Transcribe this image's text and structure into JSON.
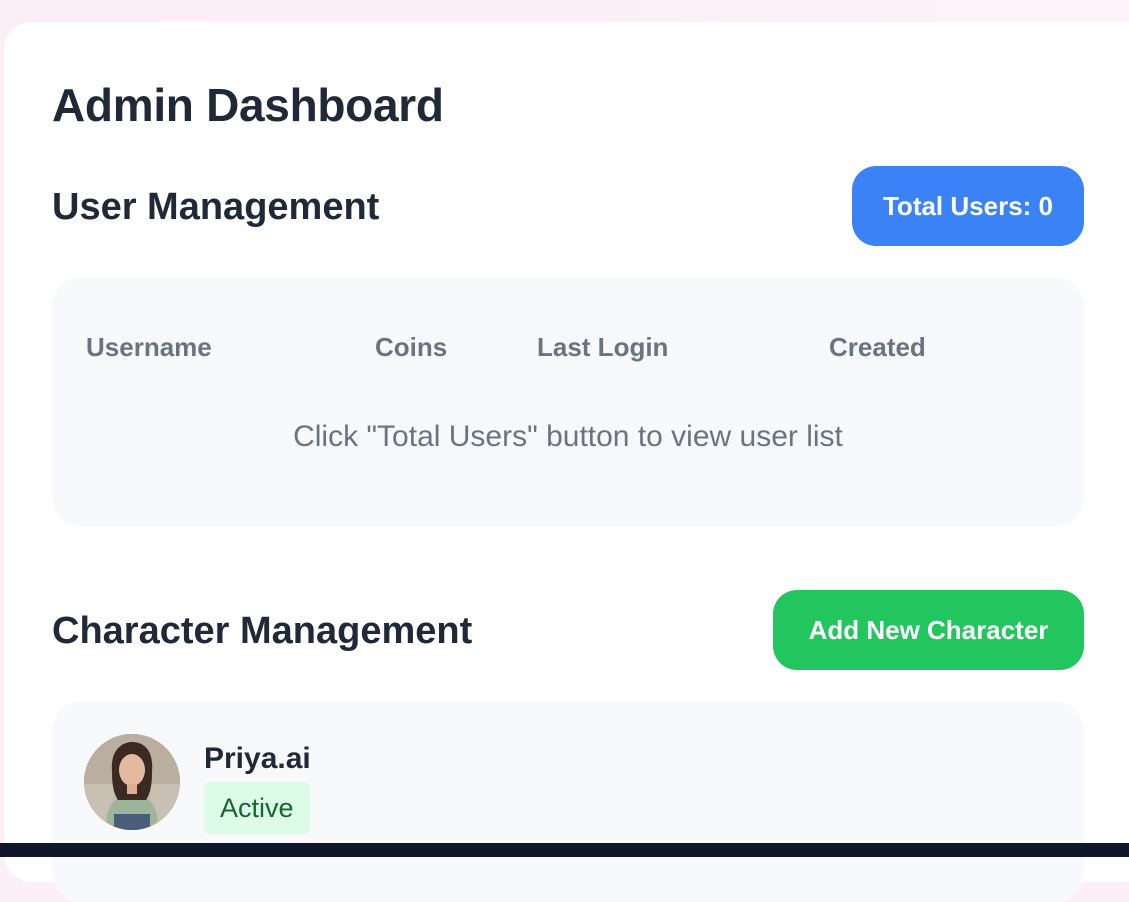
{
  "page": {
    "title": "Admin Dashboard"
  },
  "user_management": {
    "title": "User Management",
    "total_users_label": "Total Users: 0",
    "columns": [
      "Username",
      "Coins",
      "Last Login",
      "Created"
    ],
    "empty_message": "Click \"Total Users\" button to view user list"
  },
  "character_management": {
    "title": "Character Management",
    "add_button_label": "Add New Character",
    "characters": [
      {
        "name": "Priya.ai",
        "status": "Active"
      }
    ]
  },
  "colors": {
    "primary_blue": "#3b82f6",
    "success_green": "#22c55e",
    "heading": "#1f2937",
    "muted": "#6b7280",
    "status_active_bg": "#dcfce7",
    "status_active_text": "#166534"
  }
}
